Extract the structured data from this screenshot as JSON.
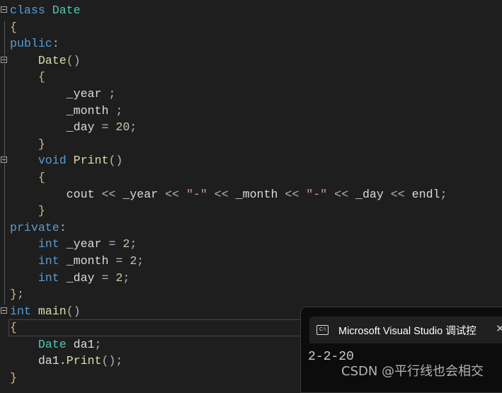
{
  "code": [
    [
      [
        "kw",
        "class "
      ],
      [
        "ty",
        "Date"
      ]
    ],
    [
      [
        "br",
        "{"
      ]
    ],
    [
      [
        "kw",
        "public"
      ],
      [
        "op",
        ":"
      ]
    ],
    [
      [
        "pl",
        "    "
      ],
      [
        "fn",
        "Date"
      ],
      [
        "op",
        "()"
      ]
    ],
    [
      [
        "pl",
        "    "
      ],
      [
        "br",
        "{"
      ]
    ],
    [
      [
        "pl",
        "        _year "
      ],
      [
        "op",
        ";"
      ]
    ],
    [
      [
        "pl",
        "        _month "
      ],
      [
        "op",
        ";"
      ]
    ],
    [
      [
        "pl",
        "        _day "
      ],
      [
        "op",
        "= "
      ],
      [
        "nu",
        "20"
      ],
      [
        "op",
        ";"
      ]
    ],
    [
      [
        "pl",
        "    "
      ],
      [
        "br",
        "}"
      ]
    ],
    [
      [
        "pl",
        "    "
      ],
      [
        "kw",
        "void "
      ],
      [
        "fn",
        "Print"
      ],
      [
        "op",
        "()"
      ]
    ],
    [
      [
        "pl",
        "    "
      ],
      [
        "br",
        "{"
      ]
    ],
    [
      [
        "pl",
        "        cout "
      ],
      [
        "op",
        "<< "
      ],
      [
        "pl",
        "_year "
      ],
      [
        "op",
        "<< "
      ],
      [
        "st",
        "\"-\" "
      ],
      [
        "op",
        "<< "
      ],
      [
        "pl",
        "_month "
      ],
      [
        "op",
        "<< "
      ],
      [
        "st",
        "\"-\" "
      ],
      [
        "op",
        "<< "
      ],
      [
        "pl",
        "_day "
      ],
      [
        "op",
        "<< "
      ],
      [
        "pl",
        "endl"
      ],
      [
        "op",
        ";"
      ]
    ],
    [
      [
        "pl",
        "    "
      ],
      [
        "br",
        "}"
      ]
    ],
    [
      [
        "kw",
        "private"
      ],
      [
        "op",
        ":"
      ]
    ],
    [
      [
        "pl",
        "    "
      ],
      [
        "kw",
        "int "
      ],
      [
        "pl",
        "_year "
      ],
      [
        "op",
        "= "
      ],
      [
        "nu",
        "2"
      ],
      [
        "op",
        ";"
      ]
    ],
    [
      [
        "pl",
        "    "
      ],
      [
        "kw",
        "int "
      ],
      [
        "pl",
        "_month "
      ],
      [
        "op",
        "= "
      ],
      [
        "nu",
        "2"
      ],
      [
        "op",
        ";"
      ]
    ],
    [
      [
        "pl",
        "    "
      ],
      [
        "kw",
        "int "
      ],
      [
        "pl",
        "_day "
      ],
      [
        "op",
        "= "
      ],
      [
        "nu",
        "2"
      ],
      [
        "op",
        ";"
      ]
    ],
    [
      [
        "br",
        "}"
      ],
      [
        "op",
        ";"
      ]
    ],
    [
      [
        "kw",
        "int "
      ],
      [
        "fn",
        "main"
      ],
      [
        "op",
        "()"
      ]
    ],
    [
      [
        "br",
        "{"
      ]
    ],
    [
      [
        "pl",
        "    "
      ],
      [
        "ty",
        "Date "
      ],
      [
        "pl",
        "da1"
      ],
      [
        "op",
        ";"
      ]
    ],
    [
      [
        "pl",
        "    da1."
      ],
      [
        "fn",
        "Print"
      ],
      [
        "op",
        "();"
      ]
    ],
    [
      [
        "br",
        "}"
      ]
    ]
  ],
  "fold_lines": [
    0,
    3,
    9,
    18
  ],
  "current_line": 19,
  "console": {
    "title": "Microsoft Visual Studio 调试控",
    "icon": "cmd-icon",
    "output": "2-2-20",
    "close": "✕"
  },
  "watermark": "CSDN @平行线也会相交"
}
